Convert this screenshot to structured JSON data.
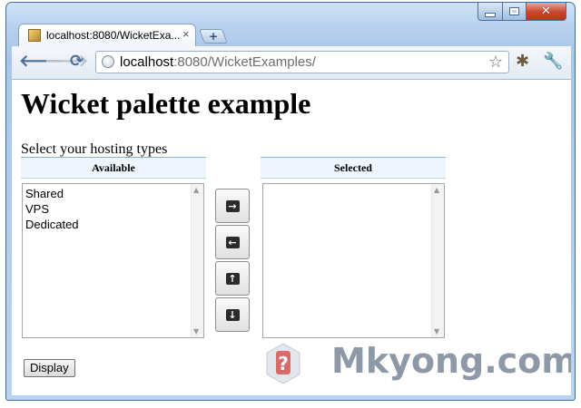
{
  "browser": {
    "tab_title": "localhost:8080/WicketExa...",
    "tab_close": "×",
    "new_tab": "+",
    "url_host": "localhost",
    "url_rest": ":8080/WicketExamples/"
  },
  "page": {
    "heading": "Wicket palette example",
    "prompt": "Select your hosting types",
    "available_header": "Available",
    "selected_header": "Selected",
    "available_items": [
      "Shared",
      "VPS",
      "Dedicated"
    ],
    "selected_items": [],
    "display_button": "Display"
  },
  "icons": {
    "move_right": "→",
    "move_left": "←",
    "move_up": "↑",
    "move_down": "↓"
  },
  "watermark": {
    "text": "Mkyong.com"
  },
  "colors": {
    "header_bg": "#eef5fd",
    "chrome_blue": "#a9c6e8",
    "close_red": "#c9452d"
  }
}
